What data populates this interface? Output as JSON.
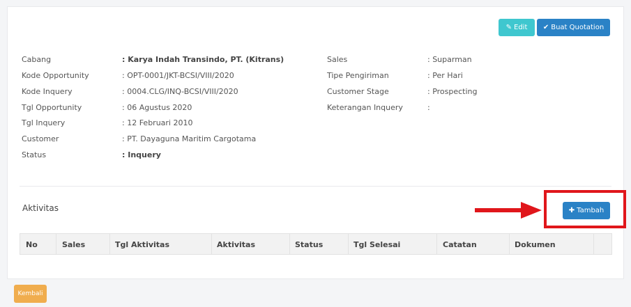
{
  "toolbar": {
    "edit_label": "Edit",
    "quotation_label": "Buat Quotation"
  },
  "left_info": [
    {
      "label": "Cabang",
      "value": ": Karya Indah Transindo, PT. (Kitrans)"
    },
    {
      "label": "Kode Opportunity",
      "value": ": OPT-0001/JKT-BCSI/VIII/2020"
    },
    {
      "label": "Kode Inquery",
      "value": ": 0004.CLG/INQ-BCSI/VIII/2020"
    },
    {
      "label": "Tgl Opportunity",
      "value": ": 06 Agustus 2020"
    },
    {
      "label": "Tgl Inquery",
      "value": ": 12 Februari 2010"
    },
    {
      "label": "Customer",
      "value": ": PT. Dayaguna Maritim Cargotama"
    },
    {
      "label": "Status",
      "value": ": Inquery"
    }
  ],
  "right_info": [
    {
      "label": "Sales",
      "value": ": Suparman"
    },
    {
      "label": "Tipe Pengiriman",
      "value": ": Per Hari"
    },
    {
      "label": "Customer Stage",
      "value": ": Prospecting"
    },
    {
      "label": "Keterangan Inquery",
      "value": ":"
    }
  ],
  "activities": {
    "title": "Aktivitas",
    "add_label": "Tambah",
    "columns": [
      "No",
      "Sales",
      "Tgl Aktivitas",
      "Aktivitas",
      "Status",
      "Tgl Selesai",
      "Catatan",
      "Dokumen"
    ]
  },
  "footer": {
    "back_label": "Kembali"
  },
  "colors": {
    "edit": "#3fc7cf",
    "primary": "#2a82c6",
    "back": "#f0ad4e",
    "annotation": "#e0161b"
  }
}
